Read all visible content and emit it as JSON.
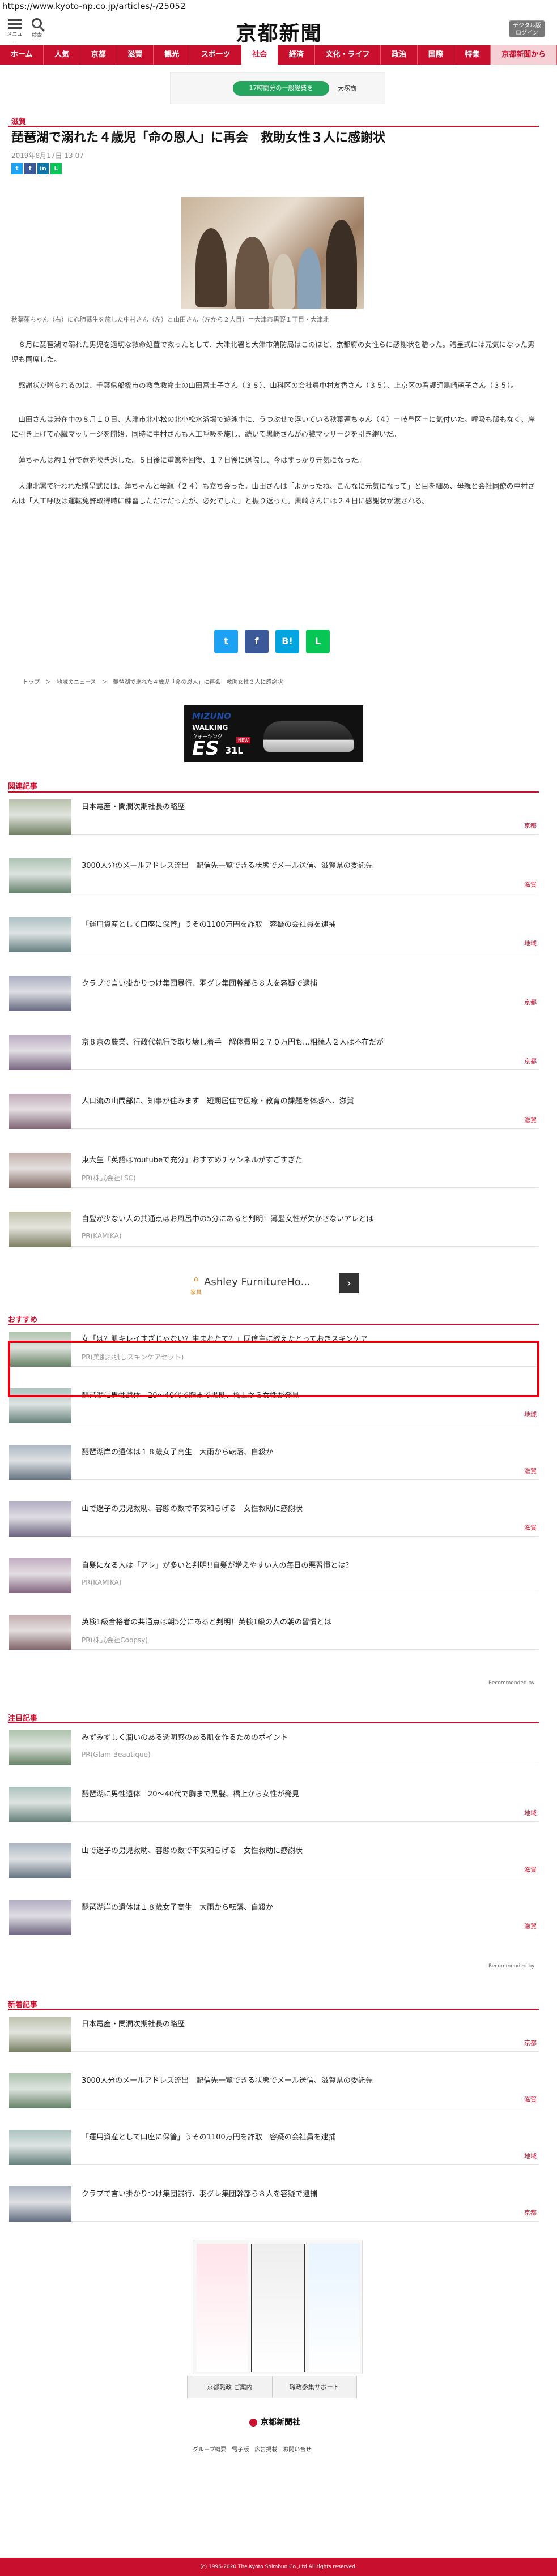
{
  "browser": {
    "url": "https://www.kyoto-np.co.jp/articles/-/25052"
  },
  "header": {
    "menu_label": "メニュー",
    "search_label": "検索",
    "logo": "京都新聞",
    "digital_button": "デジタル版\nログイン",
    "nav": [
      "ホーム",
      "人気",
      "京都",
      "滋賀",
      "観光",
      "スポーツ",
      "社会",
      "経済",
      "文化・ライフ",
      "政治",
      "国際",
      "特集",
      "京都新聞から"
    ]
  },
  "top_ad": {
    "pill": "17時間分の一般経費を",
    "text": "大塚商"
  },
  "article": {
    "section": "滋賀",
    "title": "琵琶湖で溺れた４歳児「命の恩人」に再会　救助女性３人に感謝状",
    "date": "2019年8月17日 13:07",
    "share": [
      "t",
      "f",
      "in",
      "L"
    ],
    "caption": "秋葉蓮ちゃん（右）に心肺蘇生を施した中村さん（左）と山田さん（左から２人目）＝大津市黒野１丁目・大津北",
    "paragraphs": [
      "８月に琵琶湖で溺れた男児を適切な救命処置で救ったとして、大津北署と大津市消防局はこのほど、京都府の女性らに感謝状を贈った。贈呈式には元気になった男児も同席した。",
      "感謝状が贈られるのは、千葉県船橋市の救急救命士の山田富士子さん（３８）、山科区の会社員中村友香さん（３５）、上京区の看護師黒崎萌子さん（３５）。",
      "山田さんは滞在中の８月１０日、大津市北小松の北小松水浴場で遊泳中に、うつぶせで浮いている秋葉蓮ちゃん（４）＝岐阜区＝に気付いた。呼吸も脈もなく、岸に引き上げて心臓マッサージを開始。同時に中村さんも人工呼吸を施し、続いて黒崎さんが心臓マッサージを引き継いだ。",
      "蓮ちゃんは約１分で意を吹き返した。５日後に重篤を回復、１７日後に退院し、今はすっかり元気になった。",
      "大津北署で行われた贈呈式には、蓮ちゃんと母親（２４）も立ち会った。山田さんは「よかったね、こんなに元気になって」と目を細め、母親と会社同僚の中村さんは「人工呼吸は運転免許取得時に練習しただけだったが、必死でした」と振り返った。黒崎さんには２４日に感謝状が渡される。"
    ],
    "sharebig": [
      "t",
      "f",
      "B!",
      "L"
    ],
    "breadcrumb": "トップ　＞　地域のニュース　＞　琵琶湖で溺れた４歳児「命の恩人」に再会　救助女性３人に感謝状"
  },
  "shoe_ad": {
    "brand": "MIZUNO",
    "line": "WALKING",
    "sub": "ウォーキング",
    "model": "ES",
    "model_num": "31L",
    "new": "NEW"
  },
  "related": {
    "label": "関連記事",
    "items": [
      {
        "title": "日本電産・関潤次期社長の略歴",
        "cat": "京都"
      },
      {
        "title": "3000人分のメールアドレス流出　配信先一覧できる状態でメール送信、滋賀県の委託先",
        "cat": "滋賀"
      },
      {
        "title": "「運用資産として口座に保管」うその1100万円を詐取　容疑の会社員を逮捕",
        "cat": "地域"
      },
      {
        "title": "クラブで言い掛かりつけ集団暴行、羽グレ集団幹部ら８人を容疑で逮捕",
        "cat": "京都"
      },
      {
        "title": "京８京の農業、行政代執行で取り壊し着手　解体費用２７０万円も…相続人２人は不在だが",
        "cat": "京都"
      },
      {
        "title": "人口流の山間部に、知事が住みます　短期居住で医療・教育の課題を体感へ、滋賀",
        "cat": "滋賀"
      },
      {
        "title": "東大生「英語はYoutubeで充分」おすすめチャンネルがすごすぎた",
        "sub": "PR(株式会社LSC)"
      },
      {
        "title": "自髪が少ない人の共通点はお風呂中の5分にあると判明！薄髪女性が欠かさないアレとは",
        "sub": "PR(KAMIKA)"
      }
    ]
  },
  "ashley_ad": {
    "text": "Ashley FurnitureHo...",
    "sub": "家具"
  },
  "recommend": {
    "label": "おすすめ",
    "items": [
      {
        "title": "女「は？肌キレイすぎじゃない？生まれたて？」同僚主に教えたとっておきスキンケア",
        "sub": "PR(美肌お肌しスキンケアセット)"
      },
      {
        "title": "琵琶湖に男性遺体　20～40代で胸まで黒髪、橋上から女性が発見",
        "cat": "地域"
      },
      {
        "title": "琵琶湖岸の遺体は１８歳女子高生　大雨から転落、自殺か",
        "cat": "滋賀"
      },
      {
        "title": "山で迷子の男児救助、容態の数で不安和らげる　女性救助に感謝状",
        "cat": "滋賀"
      },
      {
        "title": "自髪になる人は「アレ」が多いと判明!!自髪が増えやすい人の毎日の悪習慣とは？",
        "sub": "PR(KAMIKA)"
      },
      {
        "title": "英検1級合格者の共通点は朝5分にあると判明！英検1級の人の朝の習慣とは",
        "sub": "PR(株式会社Coopsy)"
      }
    ],
    "recommended_by": "Recommended by"
  },
  "attention": {
    "label": "注目記事",
    "items": [
      {
        "title": "みずみずしく潤いのある透明感のある肌を作るためのポイント",
        "sub": "PR(Glam Beautique)"
      },
      {
        "title": "琵琶湖に男性遺体　20～40代で胸まで黒髪、橋上から女性が発見",
        "cat": "地域"
      },
      {
        "title": "山で迷子の男児救助、容態の数で不安和らげる　女性救助に感謝状",
        "cat": "滋賀"
      },
      {
        "title": "琵琶湖岸の遺体は１８歳女子高生　大雨から転落、自殺か",
        "cat": "滋賀"
      }
    ],
    "recommended_by": "Recommended by"
  },
  "newest": {
    "label": "新着記事",
    "items": [
      {
        "title": "日本電産・関潤次期社長の略歴",
        "cat": "京都"
      },
      {
        "title": "3000人分のメールアドレス流出　配信先一覧できる状態でメール送信、滋賀県の委託先",
        "cat": "滋賀"
      },
      {
        "title": "「運用資産として口座に保管」うその1100万円を詐取　容疑の会社員を逮捕",
        "cat": "地域"
      },
      {
        "title": "クラブで言い掛かりつけ集団暴行、羽グレ集団幹部ら８人を容疑で逮捕",
        "cat": "京都"
      }
    ]
  },
  "footer": {
    "buttons": [
      "京都職政 ご案内",
      "職政参集サポート"
    ],
    "logo": "京都新聞社",
    "links": "グループ概要　電子版　広告掲載　お問い合せ",
    "copyright": "(c) 1996-2020 The Kyoto Shimbun Co.,Ltd All rights reserved."
  },
  "colors": {
    "brand": "#c8102e",
    "highlight": "#e60012"
  }
}
